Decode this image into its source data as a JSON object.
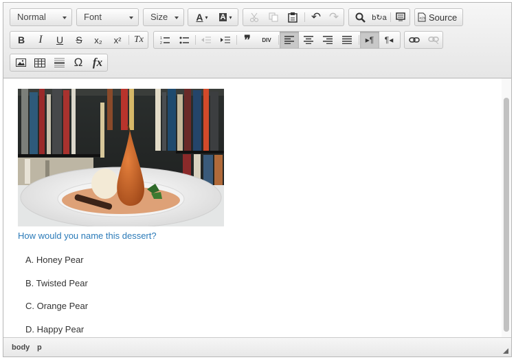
{
  "toolbar": {
    "format_combo": "Normal",
    "font_combo": "Font",
    "size_combo": "Size",
    "source_label": "Source",
    "icons": [
      "text-color-icon",
      "bg-color-icon",
      "cut-icon",
      "copy-icon",
      "paste-icon",
      "undo-icon",
      "redo-icon",
      "find-icon",
      "replace-icon",
      "select-all-icon",
      "source-icon",
      "bold-icon",
      "italic-icon",
      "underline-icon",
      "strike-icon",
      "subscript-icon",
      "superscript-icon",
      "remove-format-icon",
      "numbered-list-icon",
      "bulleted-list-icon",
      "outdent-icon",
      "indent-icon",
      "blockquote-icon",
      "div-icon",
      "align-left-icon",
      "align-center-icon",
      "align-right-icon",
      "justify-icon",
      "ltr-icon",
      "rtl-icon",
      "link-icon",
      "unlink-icon",
      "image-icon",
      "table-icon",
      "horizontal-rule-icon",
      "special-char-icon",
      "formula-icon"
    ],
    "glyphs": {
      "bold": "B",
      "italic": "I",
      "underline": "U",
      "strike": "S",
      "subscript": "x₂",
      "superscript": "x²",
      "remove_format": "Tx",
      "blockquote": "❞",
      "div": "DIV",
      "ltr": "▸¶",
      "rtl": "¶◂",
      "special_char": "Ω",
      "formula": "fx",
      "undo": "↶",
      "redo": "↷",
      "text_color": "A",
      "bg_color": "A"
    }
  },
  "content": {
    "question": "How would you name this dessert?",
    "answers": [
      "A. Honey Pear",
      "B. Twisted Pear",
      "C. Orange Pear",
      "D. Happy Pear"
    ],
    "photo_alt": "dessert-photo"
  },
  "statusbar": {
    "crumbs": [
      "body",
      "p"
    ]
  },
  "colors": {
    "question": "#2a7ab8",
    "toolbar_bg": "#e6e6e6",
    "active_button": "#c8c8c8"
  }
}
